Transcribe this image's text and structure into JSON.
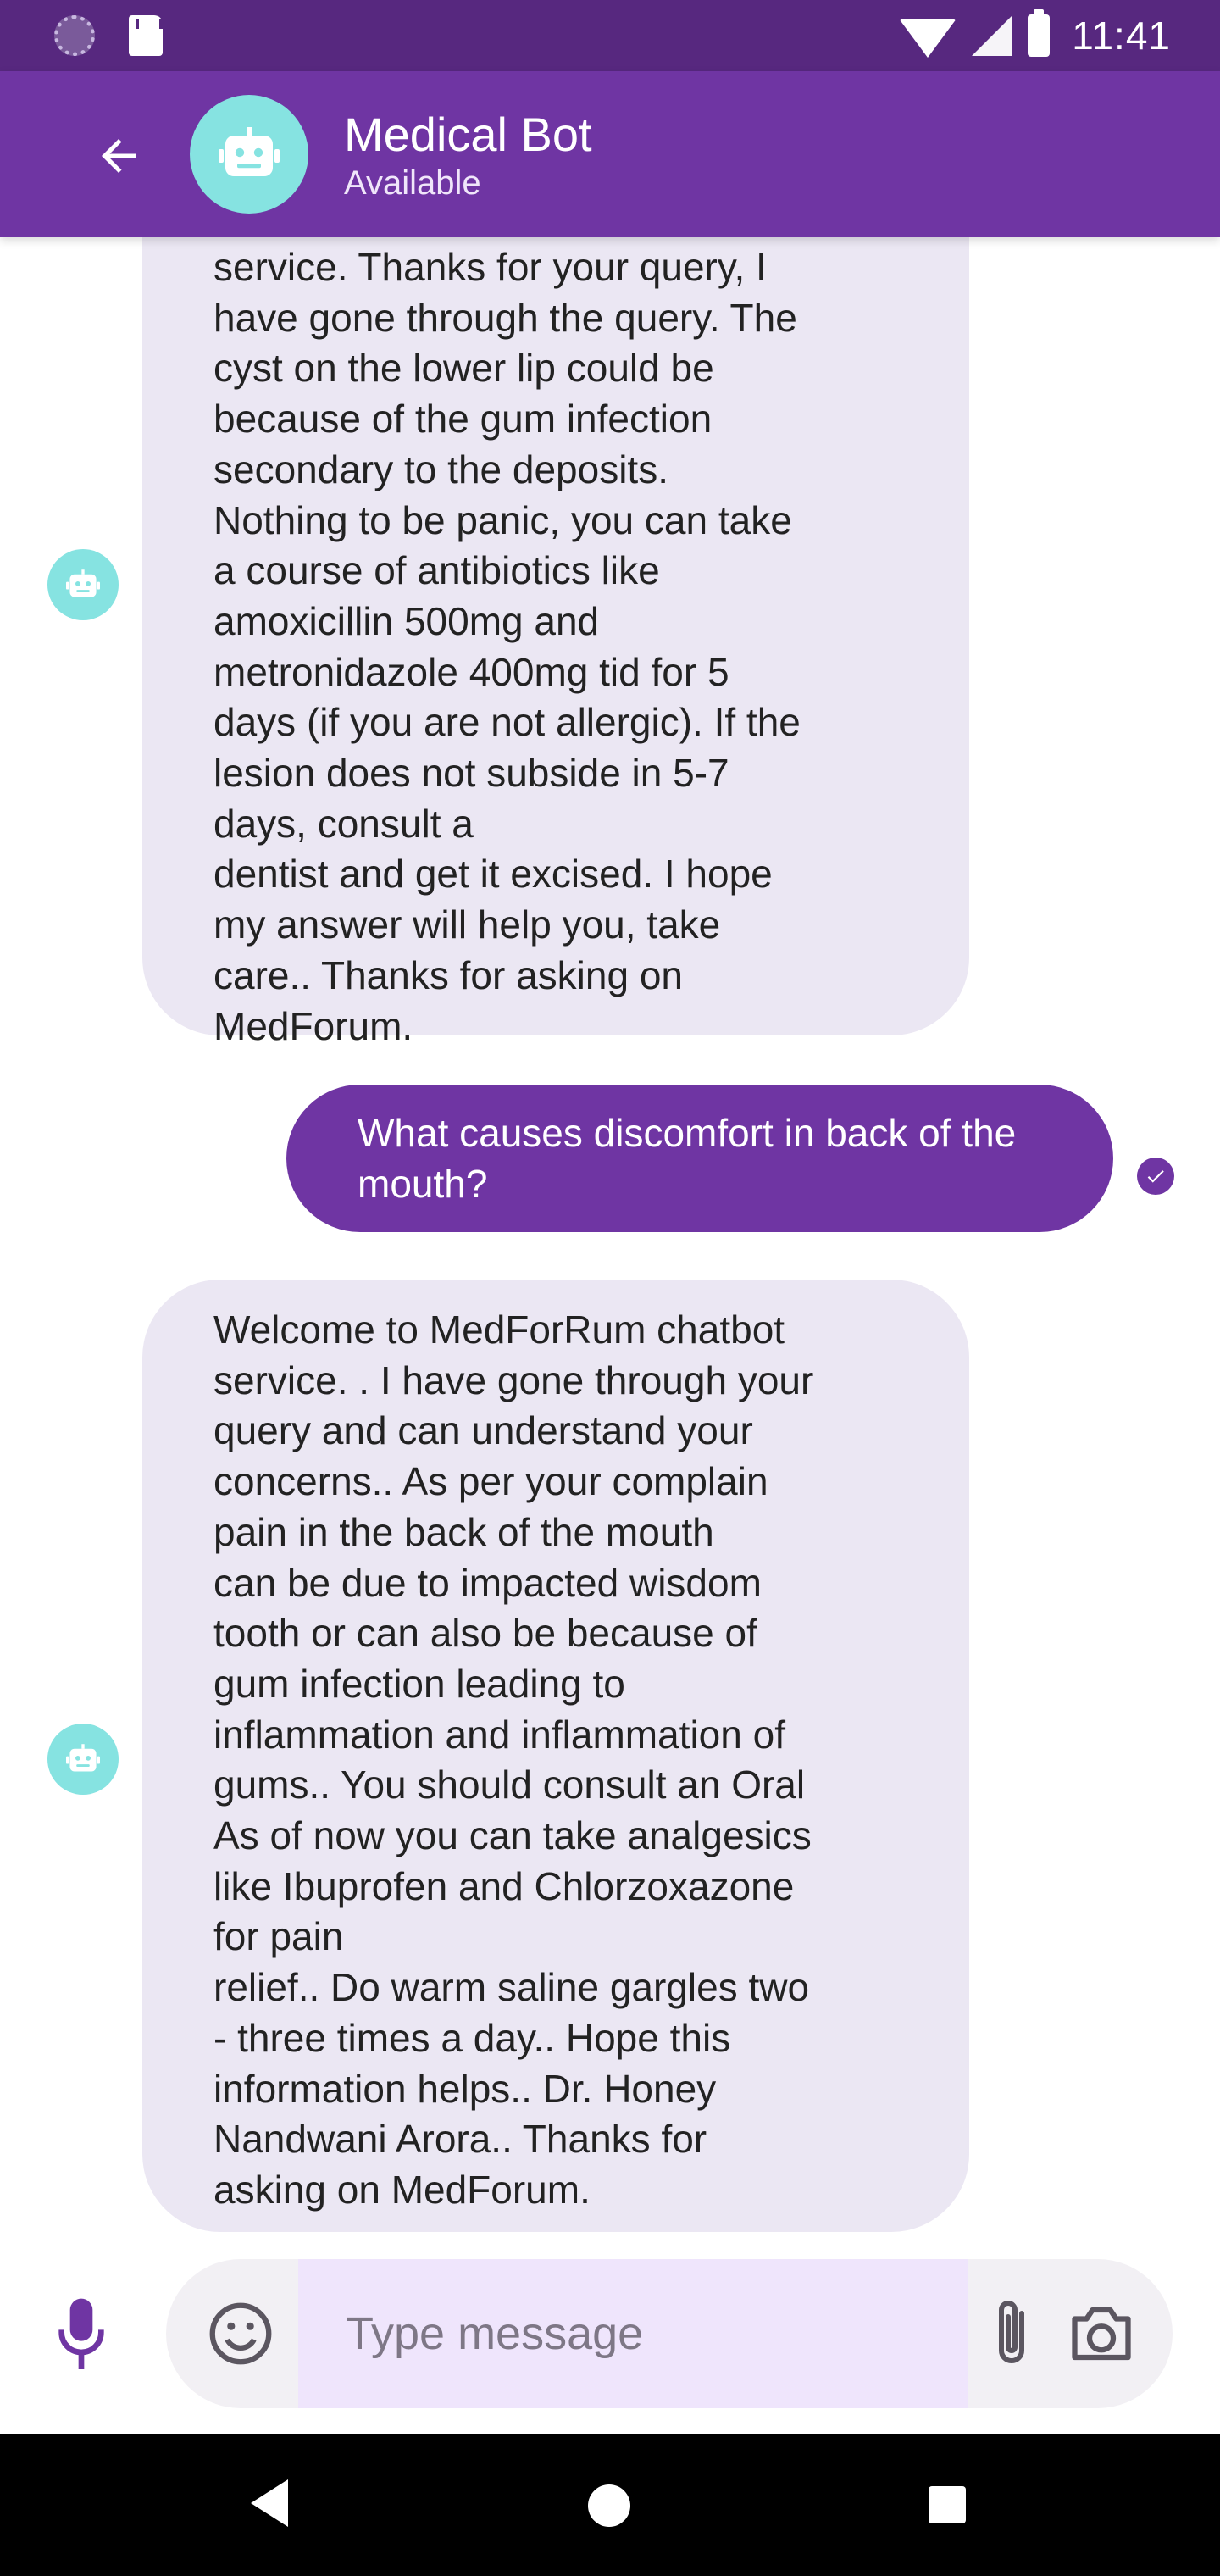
{
  "status_bar": {
    "time": "11:41"
  },
  "header": {
    "title": "Medical Bot",
    "subtitle": "Available",
    "back_icon": "arrow-left-icon",
    "avatar_icon": "robot-icon"
  },
  "messages": [
    {
      "sender": "bot",
      "text": "service. Thanks for your query, I\nhave gone through the query. The\ncyst on the lower lip could be\nbecause of the gum infection\nsecondary to the deposits.\nNothing to be panic, you can take\na course of antibiotics like\namoxicillin 500mg and\nmetronidazole 400mg tid for 5\ndays (if you are not allergic).  If the\nlesion does not subside in 5-7\ndays, consult a\ndentist and get it excised. I hope\nmy answer will help you, take\ncare.. Thanks for asking on\nMedForum."
    },
    {
      "sender": "user",
      "text": "What causes discomfort in back of the mouth?",
      "status_icon": "check-circle-icon"
    },
    {
      "sender": "bot",
      "text": "Welcome to MedForRum chatbot\nservice. . I have gone through your\nquery and can understand your\nconcerns.. As per your complain\npain in the back of the mouth\ncan be due to impacted wisdom\ntooth or can also be because of\ngum infection leading to\ninflammation and inflammation of\ngums.. You should consult an  Oral\nAs of now you can take analgesics\nlike  Ibuprofen and  Chlorzoxazone\nfor pain\nrelief.. Do warm saline gargles two\n- three times a day.. Hope this\ninformation helps.. Dr. Honey\nNandwani  Arora.. Thanks for\nasking on MedForum."
    }
  ],
  "composer": {
    "placeholder": "Type message",
    "value": "",
    "mic_icon": "microphone-icon",
    "emoji_icon": "emoji-icon",
    "attach_icon": "paperclip-icon",
    "camera_icon": "camera-icon"
  },
  "colors": {
    "status_bar": "#57287f",
    "app_bar": "#6f35a3",
    "bot_bubble": "#ebe7f3",
    "user_bubble": "#6f35a3",
    "avatar": "#86e3e1",
    "input_field": "#efe5fc"
  }
}
